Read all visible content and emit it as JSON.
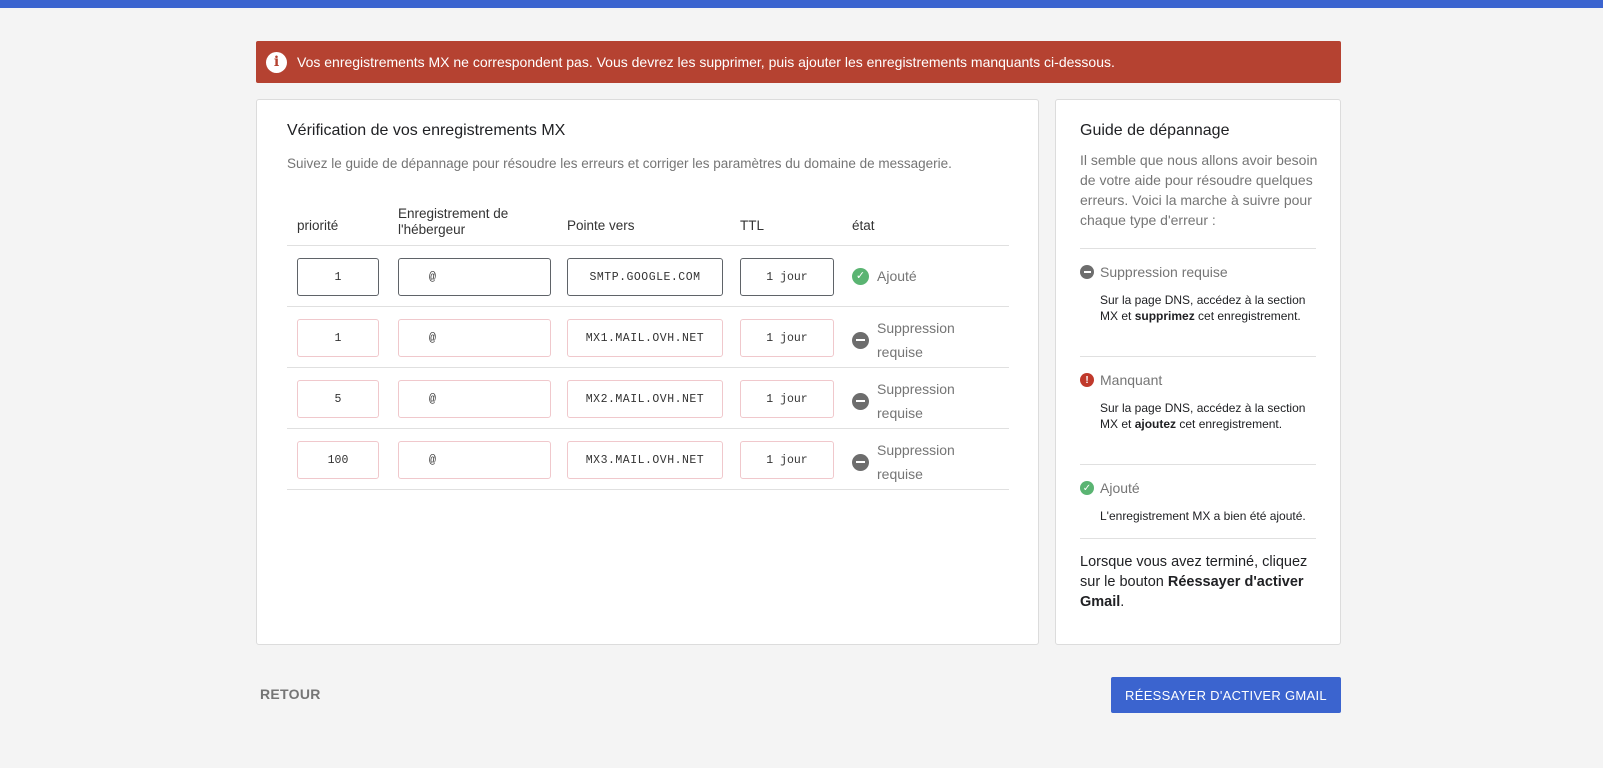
{
  "alert": {
    "message": "Vos enregistrements MX ne correspondent pas. Vous devrez les supprimer, puis ajouter les enregistrements manquants ci-dessous.",
    "icon": "info-icon"
  },
  "main": {
    "title": "Vérification de vos enregistrements MX",
    "subtitle": "Suivez le guide de dépannage pour résoudre les erreurs et corriger les paramètres du domaine de messagerie.",
    "columns": {
      "priority": "priorité",
      "host": "Enregistrement de l'hébergeur",
      "points_to": "Pointe vers",
      "ttl": "TTL",
      "state": "état"
    },
    "rows": [
      {
        "priority": "1",
        "host": "@",
        "points_to": "SMTP.GOOGLE.COM",
        "ttl": "1 jour",
        "state": "Ajouté",
        "state_icon": "check-circle-icon"
      },
      {
        "priority": "1",
        "host": "@",
        "points_to": "MX1.MAIL.OVH.NET",
        "ttl": "1 jour",
        "state": "Suppression requise",
        "state_icon": "minus-circle-icon"
      },
      {
        "priority": "5",
        "host": "@",
        "points_to": "MX2.MAIL.OVH.NET",
        "ttl": "1 jour",
        "state": "Suppression requise",
        "state_icon": "minus-circle-icon"
      },
      {
        "priority": "100",
        "host": "@",
        "points_to": "MX3.MAIL.OVH.NET",
        "ttl": "1 jour",
        "state": "Suppression requise",
        "state_icon": "minus-circle-icon"
      }
    ]
  },
  "guide": {
    "title": "Guide de dépannage",
    "intro": "Il semble que nous allons avoir besoin de votre aide pour résoudre quelques erreurs. Voici la marche à suivre pour chaque type d'erreur :",
    "items": [
      {
        "label": "Suppression requise",
        "text_before": "Sur la page DNS, accédez à la section MX et ",
        "text_bold": "supprimez",
        "text_after": " cet enregistrement."
      },
      {
        "label": "Manquant",
        "text_before": "Sur la page DNS, accédez à la section MX et ",
        "text_bold": "ajoutez",
        "text_after": " cet enregistrement."
      },
      {
        "label": "Ajouté",
        "text": "L'enregistrement MX a bien été ajouté."
      }
    ],
    "footer_before": "Lorsque vous avez terminé, cliquez sur le bouton ",
    "footer_bold": "Réessayer d'activer Gmail",
    "footer_after": "."
  },
  "buttons": {
    "back": "RETOUR",
    "retry": "RÉESSAYER D'ACTIVER GMAIL"
  },
  "colors": {
    "accent": "#3b64cf",
    "error": "#b54231",
    "success": "#5ab472"
  }
}
